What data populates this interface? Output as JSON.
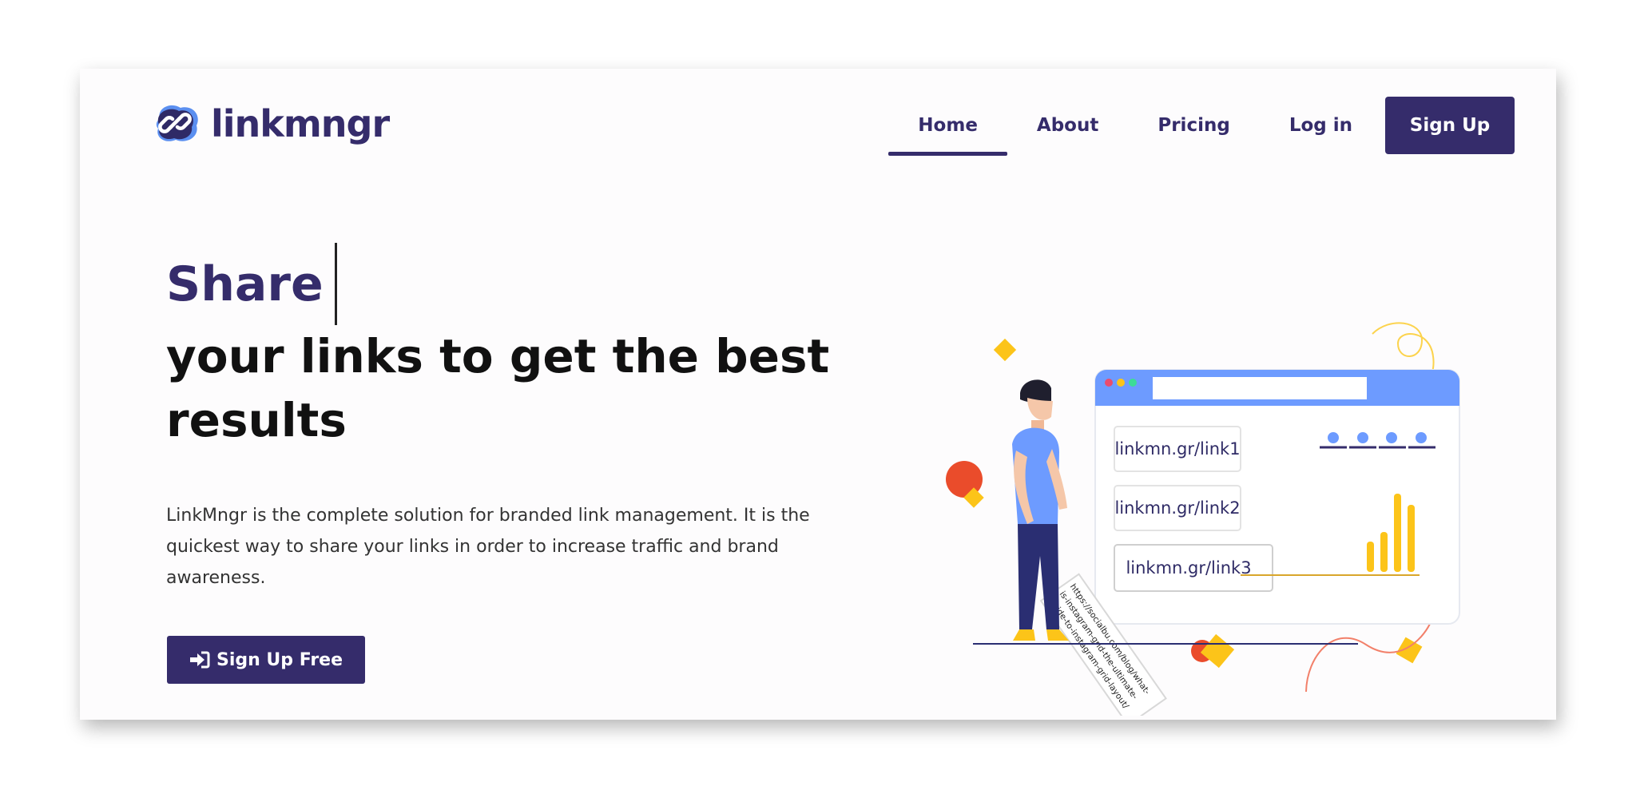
{
  "brand": {
    "name": "linkmngr"
  },
  "nav": {
    "items": [
      {
        "label": "Home",
        "active": true
      },
      {
        "label": "About",
        "active": false
      },
      {
        "label": "Pricing",
        "active": false
      },
      {
        "label": "Log in",
        "active": false
      }
    ],
    "signup_label": "Sign Up"
  },
  "hero": {
    "typed_word": "Share",
    "title": "your links to get the best results",
    "description": "LinkMngr is the complete solution for branded link management. It is the quickest way to share your links in order to increase traffic and brand awareness.",
    "cta_label": "Sign Up Free"
  },
  "illustration": {
    "links": [
      "linkmn.gr/link1",
      "linkmn.gr/link2",
      "linkmn.gr/link3"
    ],
    "paper_lines": [
      "https://socialbu.com/blog/what-",
      "is-instagram-grid-the-ultimate-",
      "guide-to-instagram-grid-layout/"
    ]
  },
  "colors": {
    "brand": "#352c6b",
    "accent_blue": "#6d9bff",
    "accent_yellow": "#fcc419",
    "accent_red": "#ea4c2b"
  },
  "icons": {
    "logo": "link-chain-icon",
    "cta": "sign-in-icon"
  }
}
